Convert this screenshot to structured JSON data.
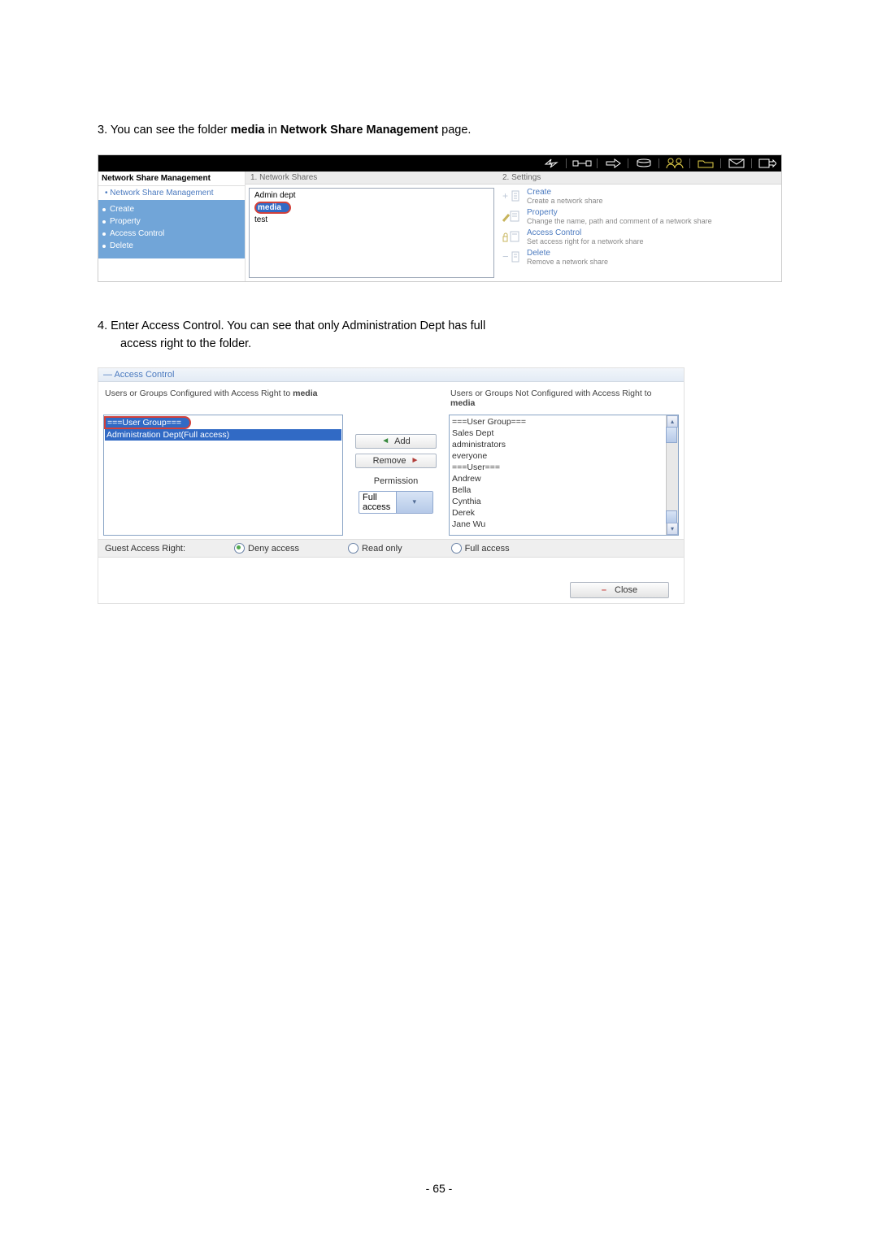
{
  "step3": {
    "prefix": "3.  You can see the folder ",
    "bold1": "media",
    "mid": " in ",
    "bold2": "Network Share Management",
    "suffix": " page."
  },
  "shot1": {
    "sidebar": {
      "header": "Network Share Management",
      "link": "• Network Share Management",
      "items": [
        "Create",
        "Property",
        "Access Control",
        "Delete"
      ]
    },
    "pane1": {
      "header": "1. Network Shares"
    },
    "pane2": {
      "header": "2. Settings"
    },
    "tree": {
      "items": [
        "Admin dept",
        "media",
        "test"
      ],
      "highlighted": "media"
    },
    "settings": [
      {
        "title": "Create",
        "desc": "Create a network share"
      },
      {
        "title": "Property",
        "desc": "Change the name, path and comment of a network share"
      },
      {
        "title": "Access Control",
        "desc": "Set access right for a network share"
      },
      {
        "title": "Delete",
        "desc": "Remove a network share"
      }
    ]
  },
  "step4": {
    "line1": "4.  Enter Access Control.  You can see that only Administration Dept has full",
    "line2": "access right to the folder."
  },
  "shot2": {
    "header": "— Access Control",
    "leftHeadA": "Users or Groups Configured with Access Right to ",
    "leftHeadB": "media",
    "rightHeadA": "Users or Groups Not Configured with Access Right to ",
    "rightHeadB": "media",
    "leftList": {
      "groupHeader": "===User Group===",
      "selected": "Administration Dept(Full access)"
    },
    "rightList": [
      "===User Group===",
      "Sales Dept",
      "administrators",
      "everyone",
      "===User===",
      "Andrew",
      "Bella",
      "Cynthia",
      "Derek",
      "Jane Wu"
    ],
    "buttons": {
      "add": "Add",
      "remove": "Remove",
      "perm": "Permission",
      "permSel": "Full access"
    },
    "guestRow": {
      "label": "Guest Access Right:",
      "opt1": "Deny access",
      "opt2": "Read only",
      "opt3": "Full access"
    },
    "close": "Close"
  },
  "pageNumber": "- 65 -"
}
